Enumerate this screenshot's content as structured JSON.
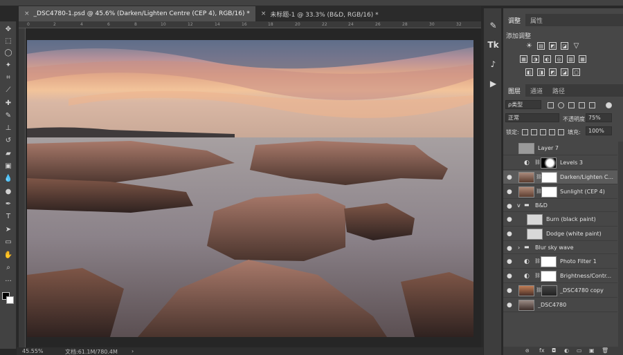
{
  "tabs": [
    {
      "label": "_DSC4780-1.psd @ 45.6% (Darken/Lighten Centre (CEP 4), RGB/16) *",
      "close": "×",
      "active": true
    },
    {
      "label": "未标题-1 @ 33.3% (B&D, RGB/16) *",
      "close": "×",
      "active": false
    }
  ],
  "ruler": {
    "ticks": [
      "0",
      "2",
      "4",
      "6",
      "8",
      "10",
      "12",
      "14",
      "16",
      "18",
      "20",
      "22",
      "24",
      "26",
      "28",
      "30",
      "32"
    ]
  },
  "status": {
    "zoom": "45.55%",
    "doc": "文档:61.1M/780.4M",
    "arrow": "›"
  },
  "tools": [
    "move-icon",
    "marquee-icon",
    "lasso-icon",
    "magic-wand-icon",
    "crop-icon",
    "eyedropper-icon",
    "healing-brush-icon",
    "brush-icon",
    "clone-stamp-icon",
    "history-brush-icon",
    "eraser-icon",
    "gradient-icon",
    "blur-icon",
    "dodge-icon",
    "pen-icon",
    "type-icon",
    "path-selection-icon",
    "rectangle-icon",
    "hand-icon",
    "zoom-icon",
    "more-icon"
  ],
  "midstrip": {
    "buttons": [
      {
        "icon": "brush-preset-icon",
        "glyph": "✎"
      },
      {
        "icon": "tk-panel-icon",
        "glyph": "Tk"
      },
      {
        "icon": "action-icon",
        "glyph": "♪"
      },
      {
        "icon": "play-icon",
        "glyph": "▶"
      }
    ]
  },
  "adjustments": {
    "tabs": [
      "调整",
      "属性"
    ],
    "title": "添加调整",
    "row1": [
      "☀",
      "▤",
      "◩",
      "◪",
      "▽"
    ],
    "row2": [
      "▦",
      "◑",
      "◐",
      "◎",
      "▥",
      "▦"
    ],
    "row3": [
      "◧",
      "◨",
      "◩",
      "◪",
      "▢"
    ]
  },
  "layers_panel": {
    "tabs": [
      "图层",
      "通道",
      "路径"
    ],
    "filter_label": "ρ类型",
    "blend_mode": "正常",
    "opacity_label": "不透明度:",
    "opacity_value": "75%",
    "lock_label": "锁定:",
    "fill_label": "填充:",
    "fill_value": "100%",
    "layers": [
      {
        "name": "Layer 7",
        "eye": "",
        "selected": false,
        "thumb_color": "#9a9a9a",
        "adjust": "",
        "mask": false,
        "indent": 0
      },
      {
        "name": "Levels 3",
        "eye": "",
        "selected": false,
        "thumb_color": "",
        "adjust": "◐",
        "mask": true,
        "indent": 0
      },
      {
        "name": "Darken/Lighten C...",
        "eye": "●",
        "selected": true,
        "thumb_color": "#7a5a48",
        "adjust": "",
        "mask": true,
        "indent": 0
      },
      {
        "name": "Sunlight (CEP 4)",
        "eye": "●",
        "selected": false,
        "thumb_color": "#7d5a46",
        "adjust": "",
        "mask": true,
        "indent": 0
      },
      {
        "name": "B&D",
        "eye": "●",
        "selected": false,
        "thumb_color": "",
        "adjust": "",
        "mask": false,
        "indent": 0,
        "group": "v"
      },
      {
        "name": "Burn (black paint)",
        "eye": "●",
        "selected": false,
        "thumb_color": "#d8d8d8",
        "adjust": "",
        "mask": false,
        "indent": 1
      },
      {
        "name": "Dodge (white paint)",
        "eye": "●",
        "selected": false,
        "thumb_color": "#d8d8d8",
        "adjust": "",
        "mask": false,
        "indent": 1
      },
      {
        "name": "Blur sky wave",
        "eye": "●",
        "selected": false,
        "thumb_color": "",
        "adjust": "",
        "mask": false,
        "indent": 0,
        "group": "›"
      },
      {
        "name": "Photo Filter 1",
        "eye": "●",
        "selected": false,
        "thumb_color": "",
        "adjust": "◐",
        "mask": true,
        "indent": 0
      },
      {
        "name": "Brightness/Contr...",
        "eye": "●",
        "selected": false,
        "thumb_color": "",
        "adjust": "◐",
        "mask": true,
        "indent": 0
      },
      {
        "name": "_DSC4780 copy",
        "eye": "●",
        "selected": false,
        "thumb_color": "#8a5a3e",
        "adjust": "",
        "mask": true,
        "indent": 0
      },
      {
        "name": "_DSC4780",
        "eye": "●",
        "selected": false,
        "thumb_color": "#6c5244",
        "adjust": "",
        "mask": false,
        "indent": 0
      }
    ],
    "footer": [
      "ɞ",
      "fx",
      "◘",
      "◐",
      "▭",
      "▣",
      "🗑"
    ]
  }
}
